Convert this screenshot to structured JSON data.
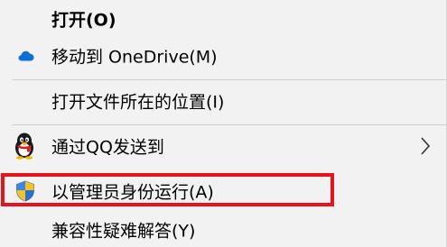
{
  "context_menu": {
    "items": [
      {
        "id": "open",
        "label": "打开(O)",
        "bold": true,
        "icon": ""
      },
      {
        "id": "move-to-onedrive",
        "label": "移动到 OneDrive(M)",
        "icon": "onedrive-cloud-icon"
      },
      {
        "id": "open-file-location",
        "label": "打开文件所在的位置(I)",
        "icon": ""
      },
      {
        "id": "send-via-qq",
        "label": "通过QQ发送到",
        "icon": "qq-penguin-icon",
        "has_submenu": true,
        "submenu_icon": "chevron-right-icon"
      },
      {
        "id": "run-as-admin",
        "label": "以管理员身份运行(A)",
        "icon": "uac-shield-icon",
        "highlighted": true
      },
      {
        "id": "compatibility-troubleshoot",
        "label": "兼容性疑难解答(Y)",
        "icon": ""
      }
    ]
  },
  "colors": {
    "menu_background": "#f2f2f2",
    "separator": "#cfcfcf",
    "highlight_border": "#e8141b",
    "onedrive_blue": "#0a6fd6",
    "shield_blue": "#2a6fd1",
    "shield_yellow": "#f2c322"
  }
}
